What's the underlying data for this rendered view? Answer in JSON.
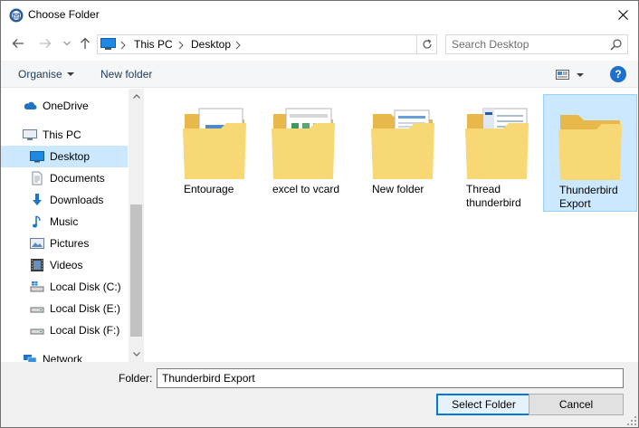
{
  "window": {
    "title": "Choose Folder"
  },
  "icons": {
    "app": "thunderbird-icon",
    "close": "close-icon",
    "back": "arrow-left-icon",
    "forward": "arrow-right-icon",
    "recent": "chevron-down-icon",
    "up": "arrow-up-icon",
    "refresh": "refresh-icon",
    "search": "search-icon",
    "help": "help-icon"
  },
  "address": {
    "crumbs": [
      "This PC",
      "Desktop"
    ]
  },
  "search": {
    "placeholder": "Search Desktop"
  },
  "toolbar": {
    "organise_label": "Organise",
    "new_folder_label": "New folder",
    "help_label": "?"
  },
  "nav": {
    "items": [
      {
        "label": "OneDrive",
        "icon": "cloud-icon"
      },
      {
        "label": "This PC",
        "icon": "computer-icon"
      },
      {
        "label": "Desktop",
        "icon": "desktop-icon",
        "selected": true
      },
      {
        "label": "Documents",
        "icon": "documents-icon"
      },
      {
        "label": "Downloads",
        "icon": "download-arrow-icon"
      },
      {
        "label": "Music",
        "icon": "music-note-icon"
      },
      {
        "label": "Pictures",
        "icon": "pictures-icon"
      },
      {
        "label": "Videos",
        "icon": "film-icon"
      },
      {
        "label": "Local Disk (C:)",
        "icon": "drive-icon"
      },
      {
        "label": "Local Disk (E:)",
        "icon": "drive-icon"
      },
      {
        "label": "Local Disk (F:)",
        "icon": "drive-icon"
      },
      {
        "label": "Network",
        "icon": "network-icon"
      }
    ]
  },
  "folders": [
    {
      "line1": "Entourage",
      "line2": ""
    },
    {
      "line1": "excel to vcard",
      "line2": ""
    },
    {
      "line1": "New folder",
      "line2": ""
    },
    {
      "line1": "Thread",
      "line2": "thunderbird"
    },
    {
      "line1": "Thunderbird",
      "line2": "Export",
      "selected": true
    }
  ],
  "footer": {
    "folder_label": "Folder:",
    "folder_value": "Thunderbird Export",
    "select_label": "Select Folder",
    "cancel_label": "Cancel"
  },
  "colors": {
    "selection": "#cce8ff",
    "accent": "#0078d7",
    "folder": "#f8d775"
  }
}
